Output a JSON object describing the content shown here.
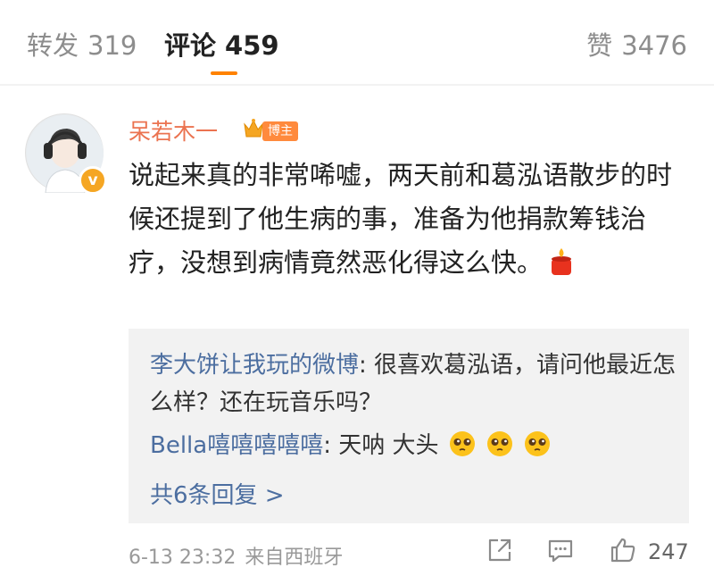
{
  "tabs": {
    "repost": {
      "label": "转发",
      "count": "319"
    },
    "comment": {
      "label": "评论",
      "count": "459"
    },
    "like": {
      "label": "赞",
      "count": "3476"
    }
  },
  "comment": {
    "username": "呆若木一",
    "badge": "博主",
    "text": "说起来真的非常唏嘘，两天前和葛泓语散步的时候还提到了他生病的事，准备为他捐款筹钱治疗，没想到病情竟然恶化得这么快。",
    "emoji": "candle-icon",
    "timestamp": "6-13 23:32",
    "source": "来自西班牙",
    "like_count": "247"
  },
  "replies": [
    {
      "user": "李大饼让我玩的微博",
      "text": ": 很喜欢葛泓语，请问他最近怎么样？还在玩音乐吗？"
    },
    {
      "user": "Bella嘻嘻嘻嘻嘻",
      "text": ": 天呐 大头",
      "emojis": [
        "pleading-face-icon",
        "pleading-face-icon",
        "pleading-face-icon"
      ]
    }
  ],
  "more_replies": "共6条回复 >",
  "colors": {
    "accent": "#ff8200",
    "username": "#eb7350",
    "link": "#4c6ea0",
    "reply_bg": "#f2f2f2"
  }
}
